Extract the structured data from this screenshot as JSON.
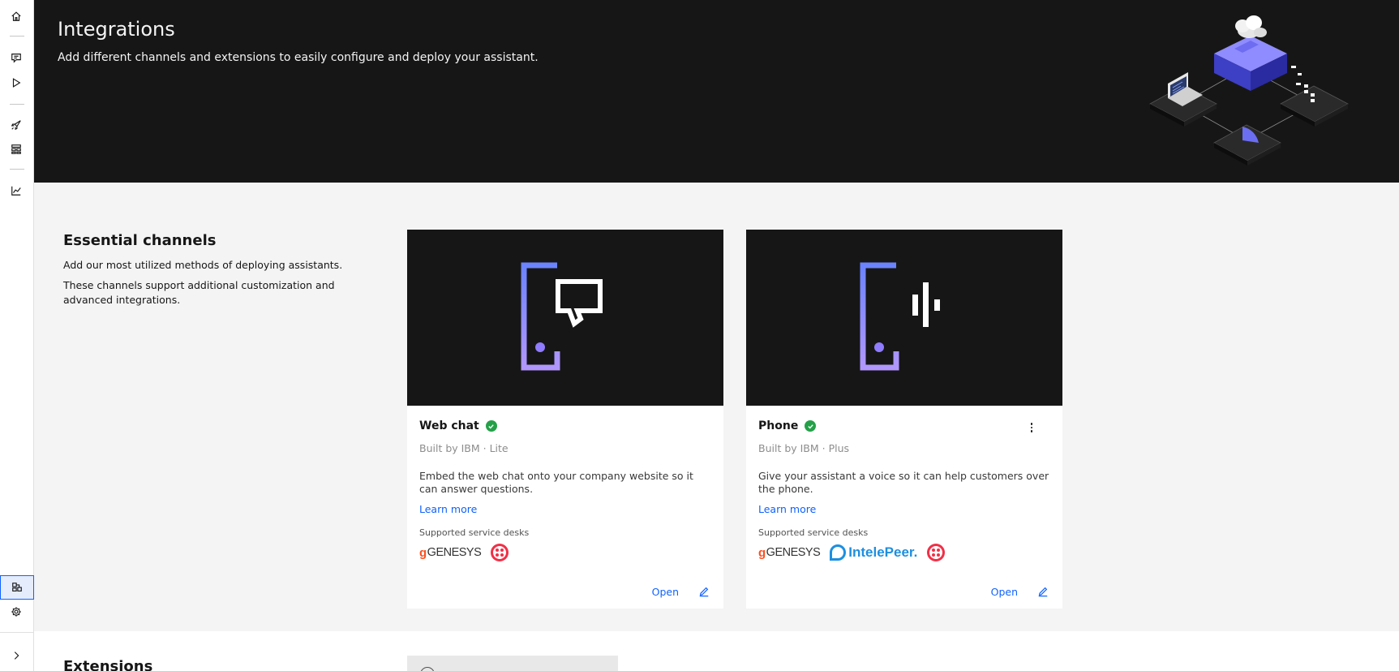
{
  "header": {
    "title": "Integrations",
    "subtitle": "Add different channels and extensions to easily configure and deploy your assistant."
  },
  "sidebar": {
    "items": [
      {
        "icon": "home-icon"
      },
      {
        "icon": "chat-icon"
      },
      {
        "icon": "play-icon"
      },
      {
        "icon": "rocket-icon"
      },
      {
        "icon": "flow-icon"
      },
      {
        "icon": "analytics-icon"
      },
      {
        "icon": "integrations-icon",
        "active": true
      },
      {
        "icon": "gear-icon"
      },
      {
        "icon": "chevron-right-icon"
      }
    ]
  },
  "essential": {
    "title": "Essential channels",
    "p1": "Add our most utilized methods of deploying assistants.",
    "p2": "These channels support additional customization and advanced integrations."
  },
  "cards": [
    {
      "name": "Web chat",
      "meta": "Built by IBM · Lite",
      "desc": "Embed the web chat onto your company website so it can answer questions.",
      "learn": "Learn more",
      "service_label": "Supported service desks",
      "logos": [
        "GENESYS",
        "twilio"
      ],
      "open": "Open"
    },
    {
      "name": "Phone",
      "meta": "Built by IBM · Plus",
      "desc": "Give your assistant a voice so it can help customers over the phone.",
      "learn": "Learn more",
      "service_label": "Supported service desks",
      "logos": [
        "GENESYS",
        "IntelePeer.",
        "twilio"
      ],
      "open": "Open"
    }
  ],
  "logo_text": {
    "genesys": "GENESYS",
    "intelepeer": "IntelePeer."
  },
  "extensions": {
    "title": "Extensions"
  },
  "colors": {
    "accent": "#0f62fe",
    "success": "#24a148",
    "hero_bg": "#161616",
    "twilio": "#f22f46",
    "intelepeer": "#1d8fe0",
    "genesys": "#ff4f1f"
  }
}
